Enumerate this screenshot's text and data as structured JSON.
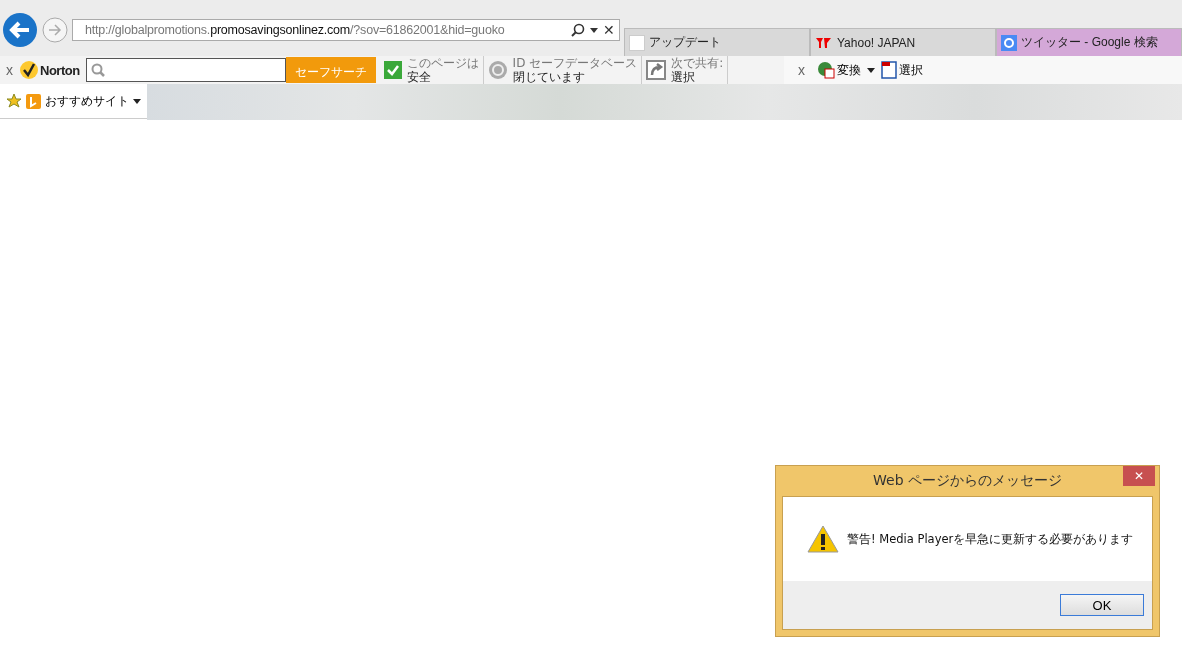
{
  "address_bar": {
    "prefix": "http://globalpromotions.",
    "domain": "promosavingsonlinez.com",
    "suffix": "/?sov=61862001&hid=guoko",
    "close": "✕"
  },
  "tabs": [
    {
      "label": "アップデート",
      "selected": false
    },
    {
      "label": "Yahoo! JAPAN",
      "selected": false
    },
    {
      "label": "ツイッター - Google 検索",
      "selected": true
    }
  ],
  "norton_toolbar": {
    "close": "x",
    "brand": "Norton",
    "search_button": "セーフサーチ",
    "items": [
      {
        "line_1": "このページは",
        "line_2": "安全"
      },
      {
        "line_1": "ID セーフデータベース",
        "line_2": "閉じています"
      },
      {
        "line_1": "次で共有:",
        "line_2": "選択"
      }
    ]
  },
  "pdf_toolbar": {
    "close": "x",
    "convert": "変換",
    "select": "選択"
  },
  "favorites_bar": {
    "site": "おすすめサイト"
  },
  "dialog": {
    "title": "Web ページからのメッセージ",
    "close": "✕",
    "message": "警告!  Media Playerを早急に更新する必要があります",
    "ok": "OK"
  }
}
